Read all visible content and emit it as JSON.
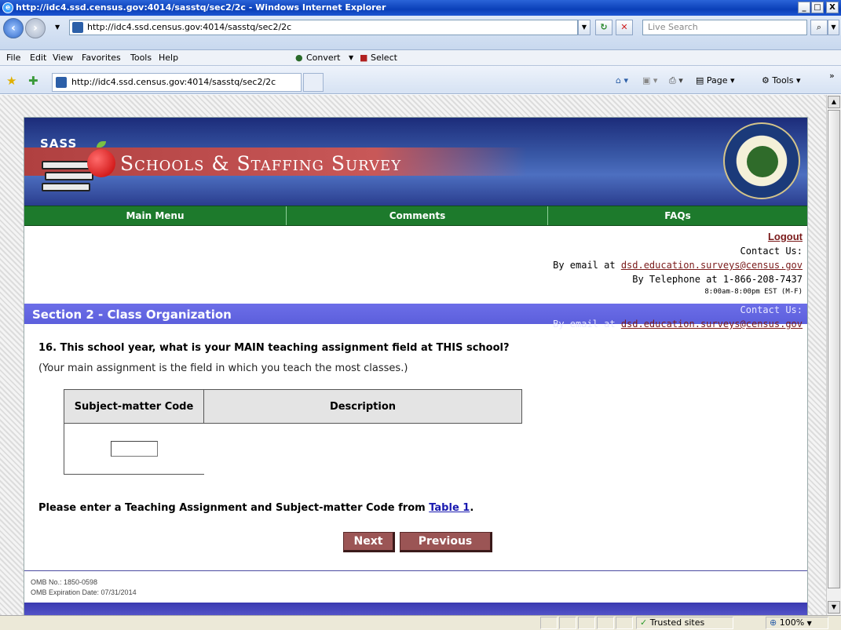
{
  "window": {
    "title": "http://idc4.ssd.census.gov:4014/sasstq/sec2/2c - Windows Internet Explorer",
    "min": "_",
    "max": "□",
    "close": "X"
  },
  "address_bar": {
    "url": "http://idc4.ssd.census.gov:4014/sasstq/sec2/2c",
    "search_placeholder": "Live Search"
  },
  "menu": {
    "items": [
      "File",
      "Edit",
      "View",
      "Favorites",
      "Tools",
      "Help"
    ],
    "convert": "Convert",
    "select": "Select"
  },
  "favorites_bar": {
    "tab_title": "http://idc4.ssd.census.gov:4014/sasstq/sec2/2c",
    "page": "Page",
    "tools": "Tools"
  },
  "banner": {
    "logo_text": "SASS",
    "title": "Schools & Staffing Survey"
  },
  "nav": {
    "items": [
      "Main Menu",
      "Comments",
      "FAQs"
    ]
  },
  "contact": {
    "logout": "Logout",
    "contact_us": "Contact Us:",
    "email_prefix": "By email at",
    "email": "dsd.education.surveys@census.gov",
    "phone": "By Telephone at 1-866-208-7437",
    "hours": "8:00am-8:00pm EST (M-F)"
  },
  "section": {
    "title": "Section 2 - Class Organization"
  },
  "question": {
    "text": "16. This school year, what is your MAIN teaching assignment field at THIS school?",
    "note": "(Your main assignment is the field in which you teach the most classes.)",
    "col_code": "Subject-matter Code",
    "col_desc": "Description",
    "code_value": ""
  },
  "instruction": {
    "prefix": "Please enter a Teaching Assignment and Subject-matter Code from",
    "link": "Table 1",
    "suffix": "."
  },
  "buttons": {
    "next": "Next",
    "previous": "Previous"
  },
  "footer": {
    "omb_no": "OMB No.: 1850-0598",
    "omb_exp": "OMB Expiration Date: 07/31/2014"
  },
  "status": {
    "zone": "Trusted sites",
    "zoom": "100%"
  }
}
